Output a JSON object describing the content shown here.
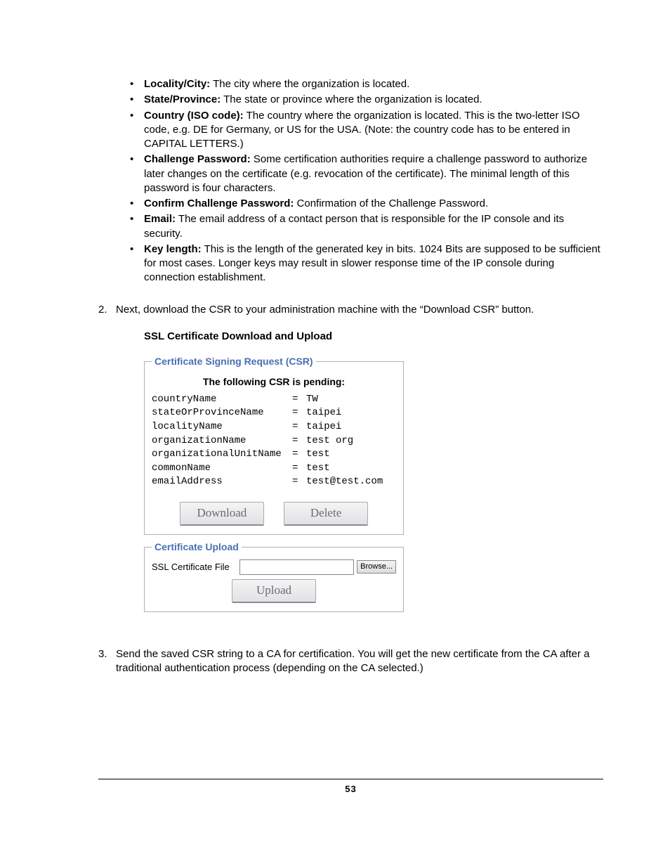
{
  "bullets": [
    {
      "label": "Locality/City:",
      "text": " The city where the organization is located."
    },
    {
      "label": "State/Province:",
      "text": " The state or province where the organization is located."
    },
    {
      "label": "Country (ISO code):",
      "text": " The country where the organization is located. This is the two-letter ISO code, e.g. DE for Germany, or US for the USA. (Note: the country code has to be entered in CAPITAL LETTERS.)"
    },
    {
      "label": "Challenge Password:",
      "text": " Some certification authorities require a challenge password to authorize later changes on the certificate (e.g. revocation of the certificate). The minimal length of this password is four characters."
    },
    {
      "label": "Confirm Challenge Password:",
      "text": " Confirmation of the Challenge Password."
    },
    {
      "label": "Email:",
      "text": " The email address of a contact person that is responsible for the IP console and its security."
    },
    {
      "label": "Key length:",
      "text": " This is the length of the generated key in bits. 1024 Bits are supposed to be sufficient for most cases. Longer keys may result in slower response time of the IP console during connection establishment."
    }
  ],
  "step2": {
    "num": "2.",
    "text": "Next, download the CSR to your administration machine with the “Download CSR” button."
  },
  "sectionTitle": "SSL Certificate Download and Upload",
  "csr": {
    "legend": "Certificate Signing Request (CSR)",
    "pending": "The following CSR is pending:",
    "rows": [
      {
        "k": "countryName",
        "v": "TW"
      },
      {
        "k": "stateOrProvinceName",
        "v": "taipei"
      },
      {
        "k": "localityName",
        "v": "taipei"
      },
      {
        "k": "organizationName",
        "v": "test org"
      },
      {
        "k": "organizationalUnitName",
        "v": "test"
      },
      {
        "k": "commonName",
        "v": "test"
      },
      {
        "k": "emailAddress",
        "v": "test@test.com"
      }
    ],
    "downloadBtn": "Download",
    "deleteBtn": "Delete"
  },
  "upload": {
    "legend": "Certificate Upload",
    "label": "SSL Certificate File",
    "browseBtn": "Browse...",
    "uploadBtn": "Upload"
  },
  "step3": {
    "num": "3.",
    "text": "Send the saved CSR string to a CA for certification. You will get the new certificate from the CA after a traditional authentication process (depending on the CA selected.)"
  },
  "pageNumber": "53"
}
